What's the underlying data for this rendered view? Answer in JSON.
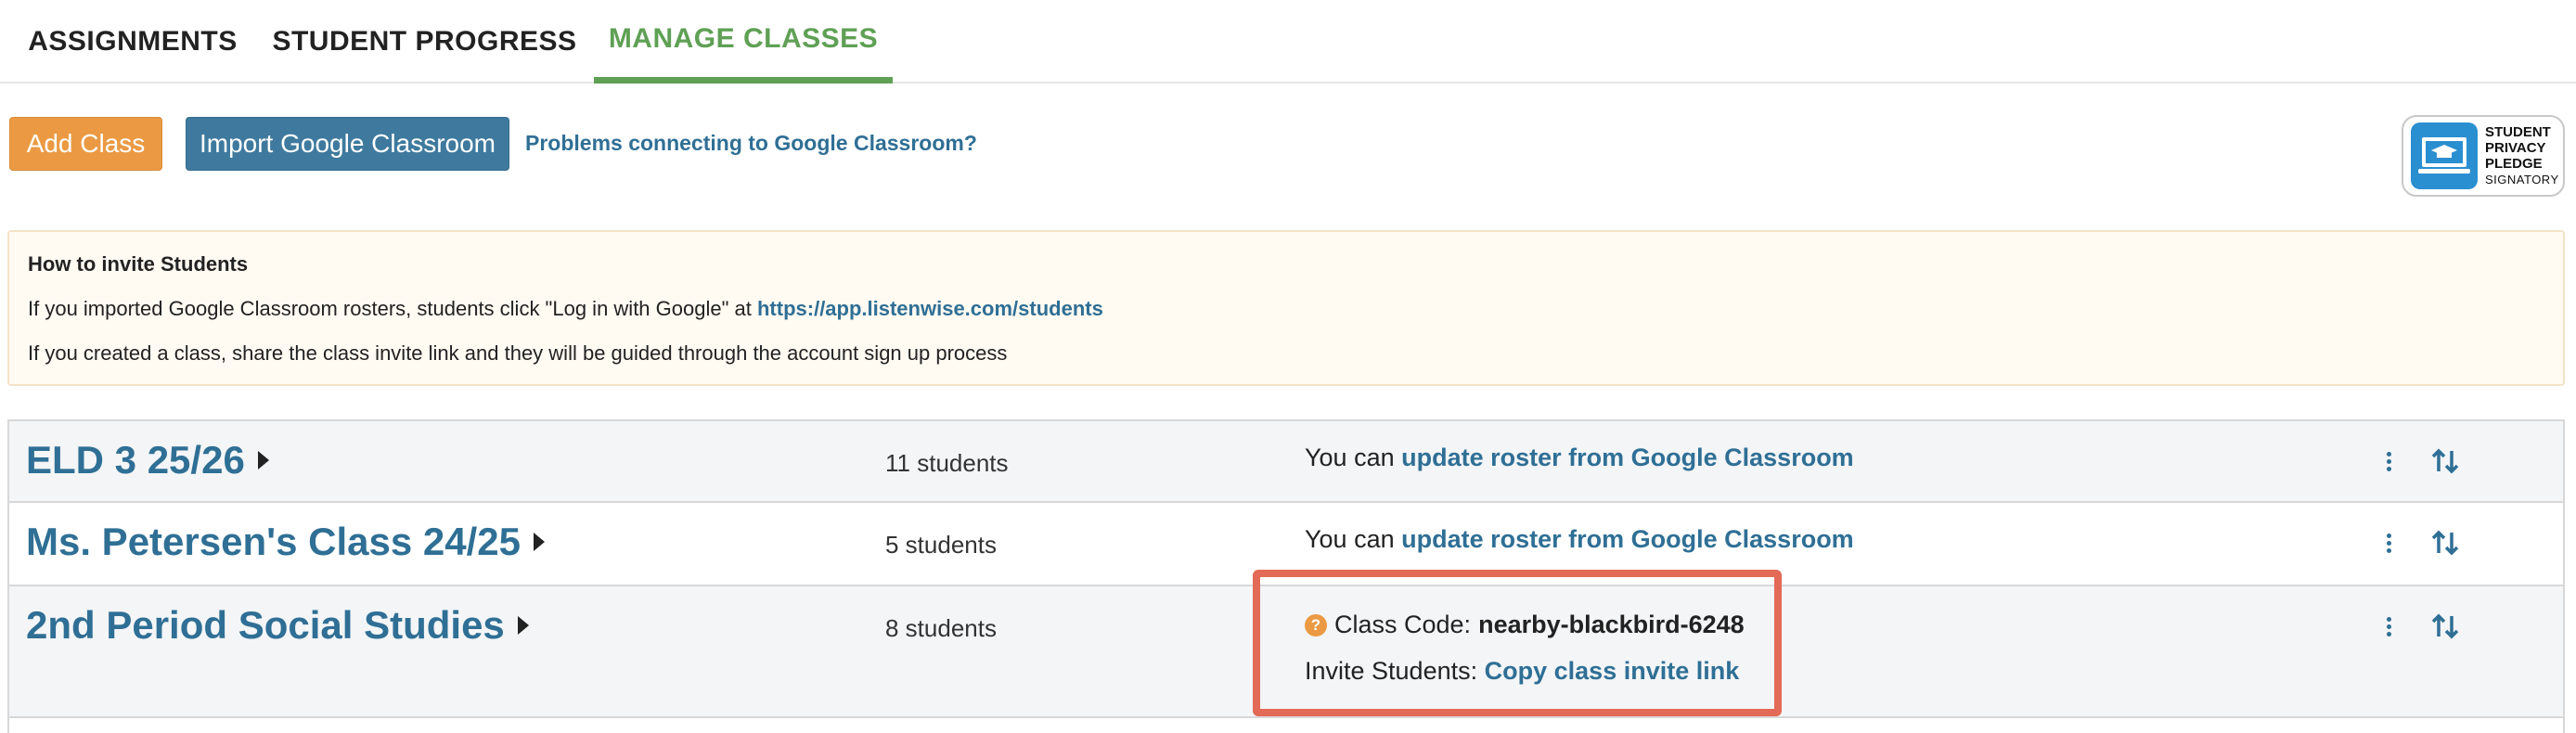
{
  "tabs": [
    {
      "label": "ASSIGNMENTS"
    },
    {
      "label": "STUDENT PROGRESS"
    },
    {
      "label": "MANAGE CLASSES"
    }
  ],
  "toolbar": {
    "add_class_label": "Add Class",
    "import_label": "Import Google Classroom",
    "help_link": "Problems connecting to Google Classroom?"
  },
  "badge": {
    "line1": "STUDENT",
    "line2": "PRIVACY",
    "line3": "PLEDGE",
    "line4": "SIGNATORY",
    "icon": "laptop-graduation-cap-icon"
  },
  "invite_info": {
    "title": "How to invite Students",
    "line1_prefix": "If you imported Google Classroom rosters, students click \"Log in with Google\" at ",
    "line1_link": "https://app.listenwise.com/students",
    "line2": "If you created a class, share the class invite link and they will be guided through the account sign up process"
  },
  "classes": [
    {
      "name": "ELD 3 25/26",
      "students": "11 students",
      "msg_prefix": "You can ",
      "msg_link": "update roster from Google Classroom"
    },
    {
      "name": "Ms. Petersen's Class 24/25",
      "students": "5 students",
      "msg_prefix": "You can ",
      "msg_link": "update roster from Google Classroom"
    },
    {
      "name": "2nd Period Social Studies",
      "students": "8 students",
      "code_label": "Class Code:",
      "code_value": "nearby-blackbird-6248",
      "invite_label": "Invite Students:",
      "invite_link": "Copy class invite link"
    }
  ],
  "colors": {
    "active_tab": "#5fa055",
    "add_button": "#eb9a43",
    "import_button": "#3f7a9e",
    "link": "#2f6f95",
    "highlight": "#e26a56"
  }
}
